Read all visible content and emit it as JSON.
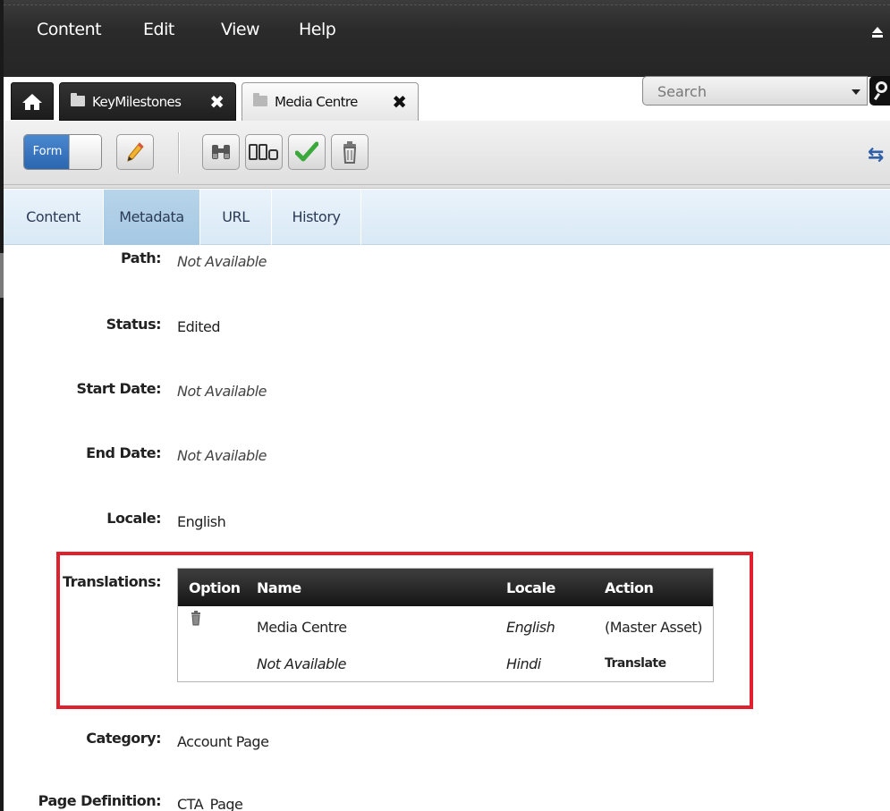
{
  "menu": [
    "Content",
    "Edit",
    "View",
    "Help"
  ],
  "tabs": [
    {
      "label": "KeyMilestones",
      "active": false
    },
    {
      "label": "Media Centre",
      "active": true
    }
  ],
  "search": {
    "placeholder": "Search"
  },
  "toolbar": {
    "form_toggle_label": "Form"
  },
  "subtabs": [
    {
      "label": "Content",
      "active": false
    },
    {
      "label": "Metadata",
      "active": true
    },
    {
      "label": "URL",
      "active": false
    },
    {
      "label": "History",
      "active": false
    }
  ],
  "fields": {
    "path": {
      "label": "Path:",
      "value": "Not Available"
    },
    "status": {
      "label": "Status:",
      "value": "Edited"
    },
    "start_date": {
      "label": "Start Date:",
      "value": "Not Available"
    },
    "end_date": {
      "label": "End Date:",
      "value": "Not Available"
    },
    "locale": {
      "label": "Locale:",
      "value": "English"
    },
    "translations": {
      "label": "Translations:"
    },
    "category": {
      "label": "Category:",
      "value": "Account Page"
    },
    "page_definition": {
      "label": "Page Definition:",
      "value": "CTA_Page"
    }
  },
  "translations_table": {
    "columns": [
      "Option",
      "Name",
      "Locale",
      "Action"
    ],
    "rows": [
      {
        "option_icon": "trash-icon",
        "name": "Media Centre",
        "locale": "English",
        "action": "(Master Asset)"
      },
      {
        "option_icon": "",
        "name": "Not Available",
        "locale": "Hindi",
        "action": "Translate"
      }
    ]
  },
  "colors": {
    "highlight_border": "#e0202c",
    "active_subtab": "#a6c8e3",
    "form_toggle": "#2b66b0"
  }
}
